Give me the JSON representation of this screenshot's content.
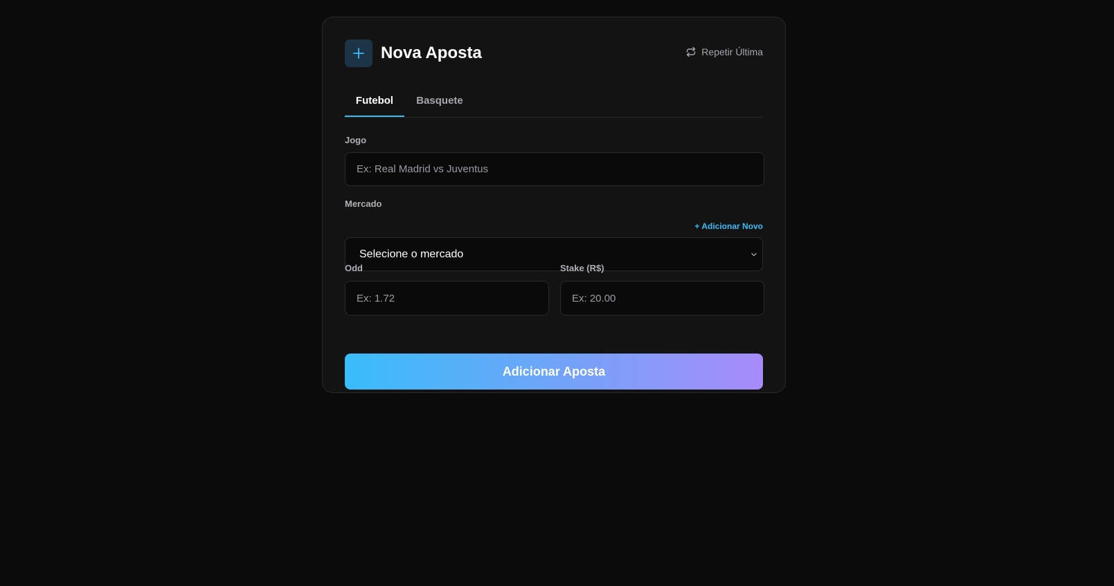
{
  "header": {
    "title": "Nova Aposta",
    "repeat_label": "Repetir Última"
  },
  "tabs": [
    {
      "label": "Futebol",
      "active": true
    },
    {
      "label": "Basquete",
      "active": false
    }
  ],
  "form": {
    "game": {
      "label": "Jogo",
      "placeholder": "Ex: Real Madrid vs Juventus",
      "value": ""
    },
    "market": {
      "label": "Mercado",
      "add_new_label": "+ Adicionar Novo",
      "selected": "Selecione o mercado"
    },
    "odd": {
      "label": "Odd",
      "placeholder": "Ex: 1.72",
      "value": ""
    },
    "stake": {
      "label": "Stake (R$)",
      "placeholder": "Ex: 20.00",
      "value": ""
    },
    "submit_label": "Adicionar Aposta"
  },
  "icons": {
    "add": "plus-icon",
    "repeat": "repeat-icon",
    "chevron": "chevron-down-icon"
  },
  "colors": {
    "accent": "#38bdf8",
    "gradient_end": "#a78bfa",
    "background": "#0b0b0c",
    "card": "#131314"
  }
}
